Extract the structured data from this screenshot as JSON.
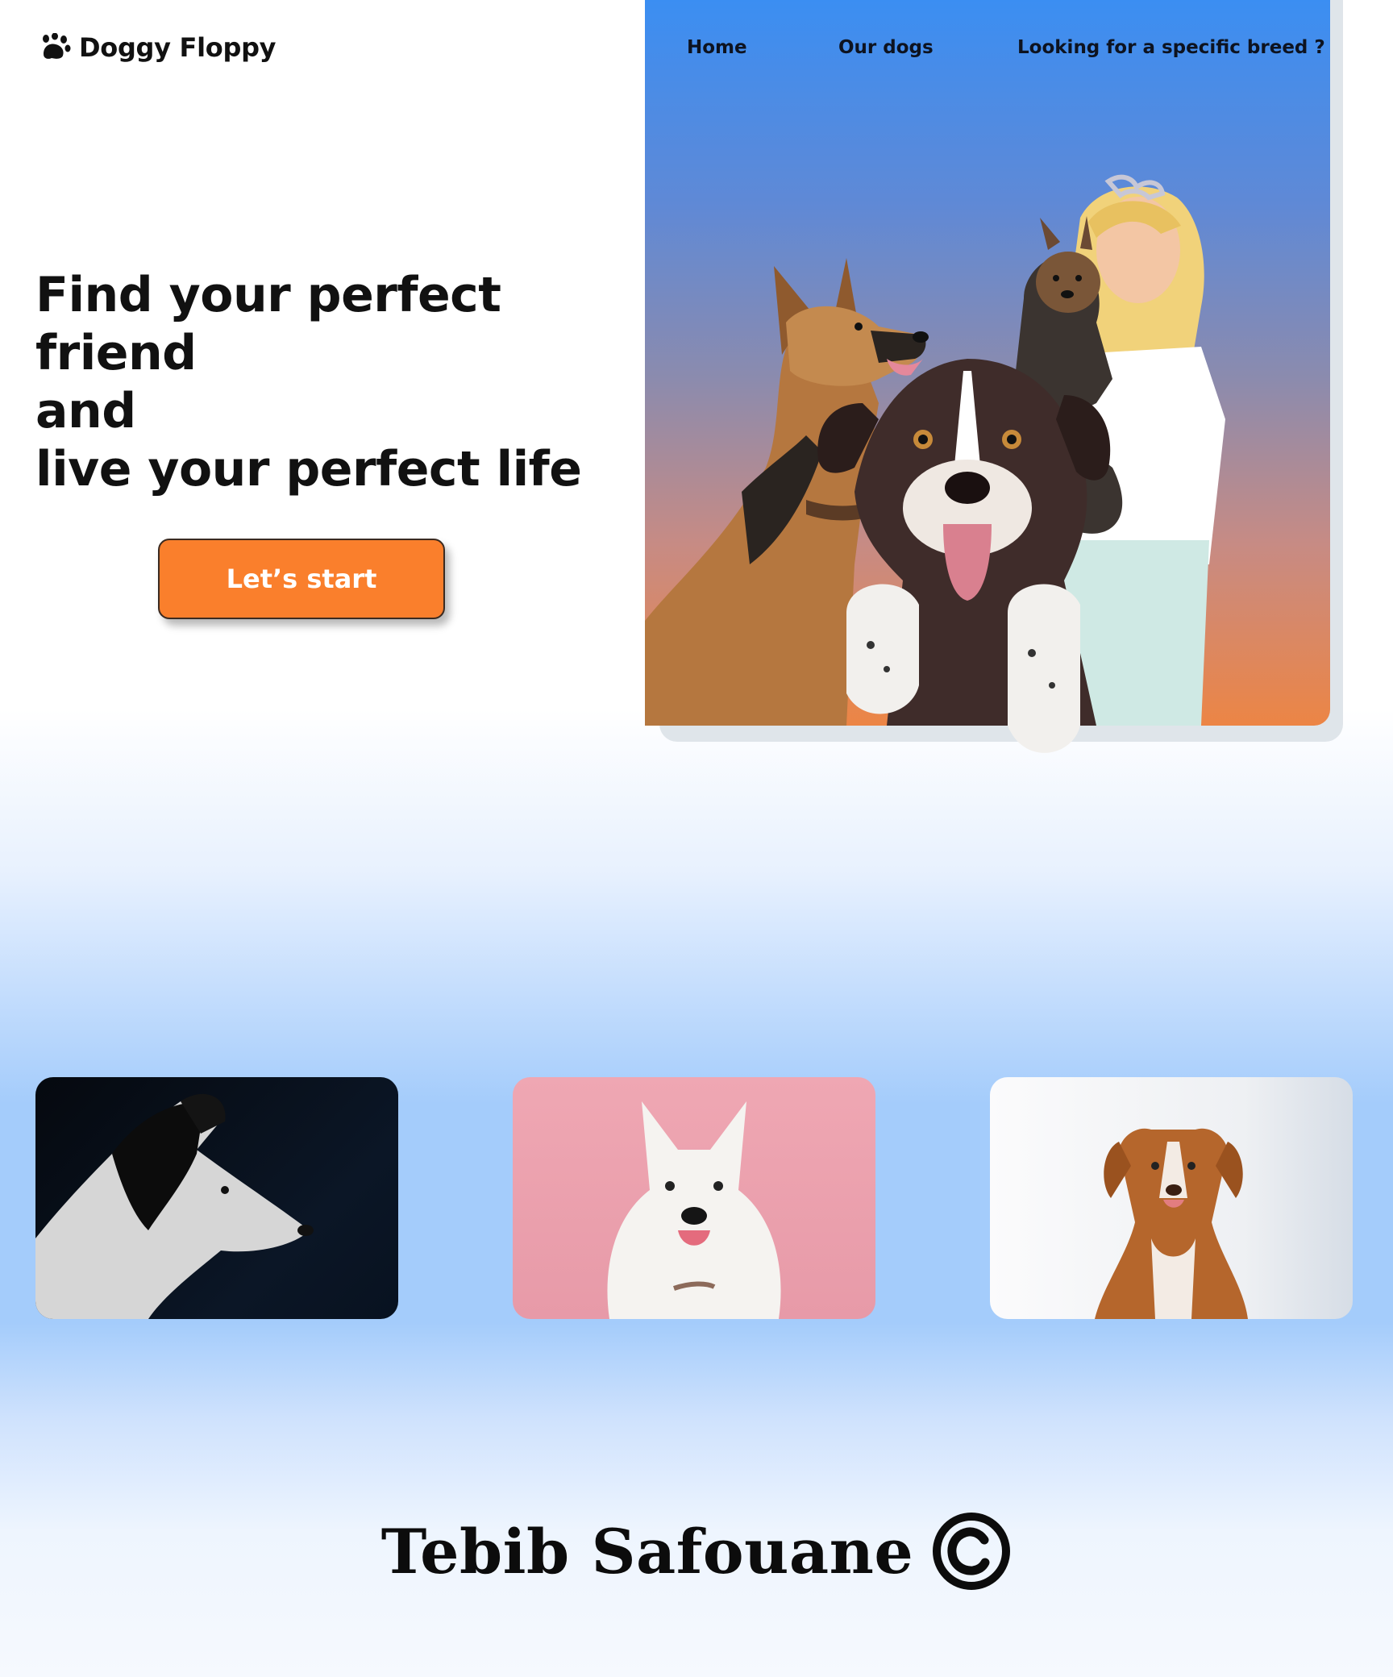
{
  "brand": {
    "name": "Doggy Floppy",
    "icon": "paw-icon"
  },
  "nav": {
    "items": [
      {
        "label": "Home"
      },
      {
        "label": "Our dogs"
      },
      {
        "label": "Looking for a specific breed ?"
      }
    ]
  },
  "hero": {
    "title_lines": [
      "Find your perfect friend",
      "and",
      "live your perfect life"
    ],
    "cta_label": "Let’s start"
  },
  "gallery": {
    "items": [
      {
        "subject": "border collie profile photo"
      },
      {
        "subject": "samoyed photo"
      },
      {
        "subject": "retriever photo"
      }
    ]
  },
  "footer": {
    "author": "Tebib Safouane",
    "icon": "copyright-icon"
  },
  "colors": {
    "accent": "#fa7f2c",
    "panel_top": "#3b8ef2",
    "panel_bottom": "#ec8545",
    "gallery_band": "#a4ccfb"
  }
}
